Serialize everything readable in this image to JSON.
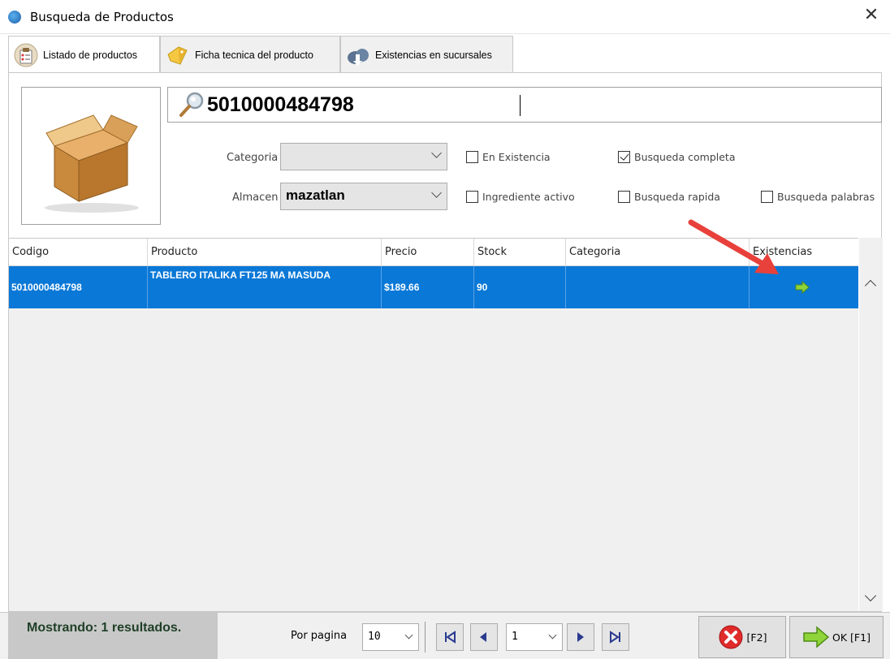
{
  "window": {
    "title": "Busqueda de Productos",
    "close_label": "✕"
  },
  "tabs": [
    {
      "label": "Listado de productos",
      "icon": "clipboard-person-icon",
      "active": true
    },
    {
      "label": "Ficha tecnica del producto",
      "icon": "tag-icon",
      "active": false
    },
    {
      "label": "Existencias en sucursales",
      "icon": "cloud-download-icon",
      "active": false
    }
  ],
  "search": {
    "value": "5010000484798",
    "placeholder": ""
  },
  "filters": {
    "categoria_label": "Categoria",
    "categoria_value": "",
    "almacen_label": "Almacen",
    "almacen_value": "mazatlan",
    "en_existencia": {
      "label": "En Existencia",
      "checked": false
    },
    "busqueda_completa": {
      "label": "Busqueda completa",
      "checked": true
    },
    "ingrediente_activo": {
      "label": "Ingrediente activo",
      "checked": false
    },
    "busqueda_rapida": {
      "label": "Busqueda rapida",
      "checked": false
    },
    "busqueda_palabras": {
      "label": "Busqueda palabras",
      "checked": false
    }
  },
  "grid": {
    "columns": [
      "Codigo",
      "Producto",
      "Precio",
      "Stock",
      "Categoria",
      "Existencias"
    ],
    "rows": [
      {
        "codigo": "5010000484798",
        "producto": "TABLERO ITALIKA FT125 MA MASUDA",
        "precio": "$189.66",
        "stock": "90",
        "categoria": "",
        "existencias_icon": "green-arrow-icon"
      }
    ]
  },
  "footer": {
    "status": "Mostrando: 1 resultados.",
    "per_page_label": "Por pagina",
    "per_page_value": "10",
    "page_value": "1",
    "cancel_label": "[F2]",
    "ok_label": "OK [F1]"
  },
  "colors": {
    "selection": "#0a78d7",
    "annotation_arrow": "#e8413b",
    "status_text": "#1f3f26"
  }
}
